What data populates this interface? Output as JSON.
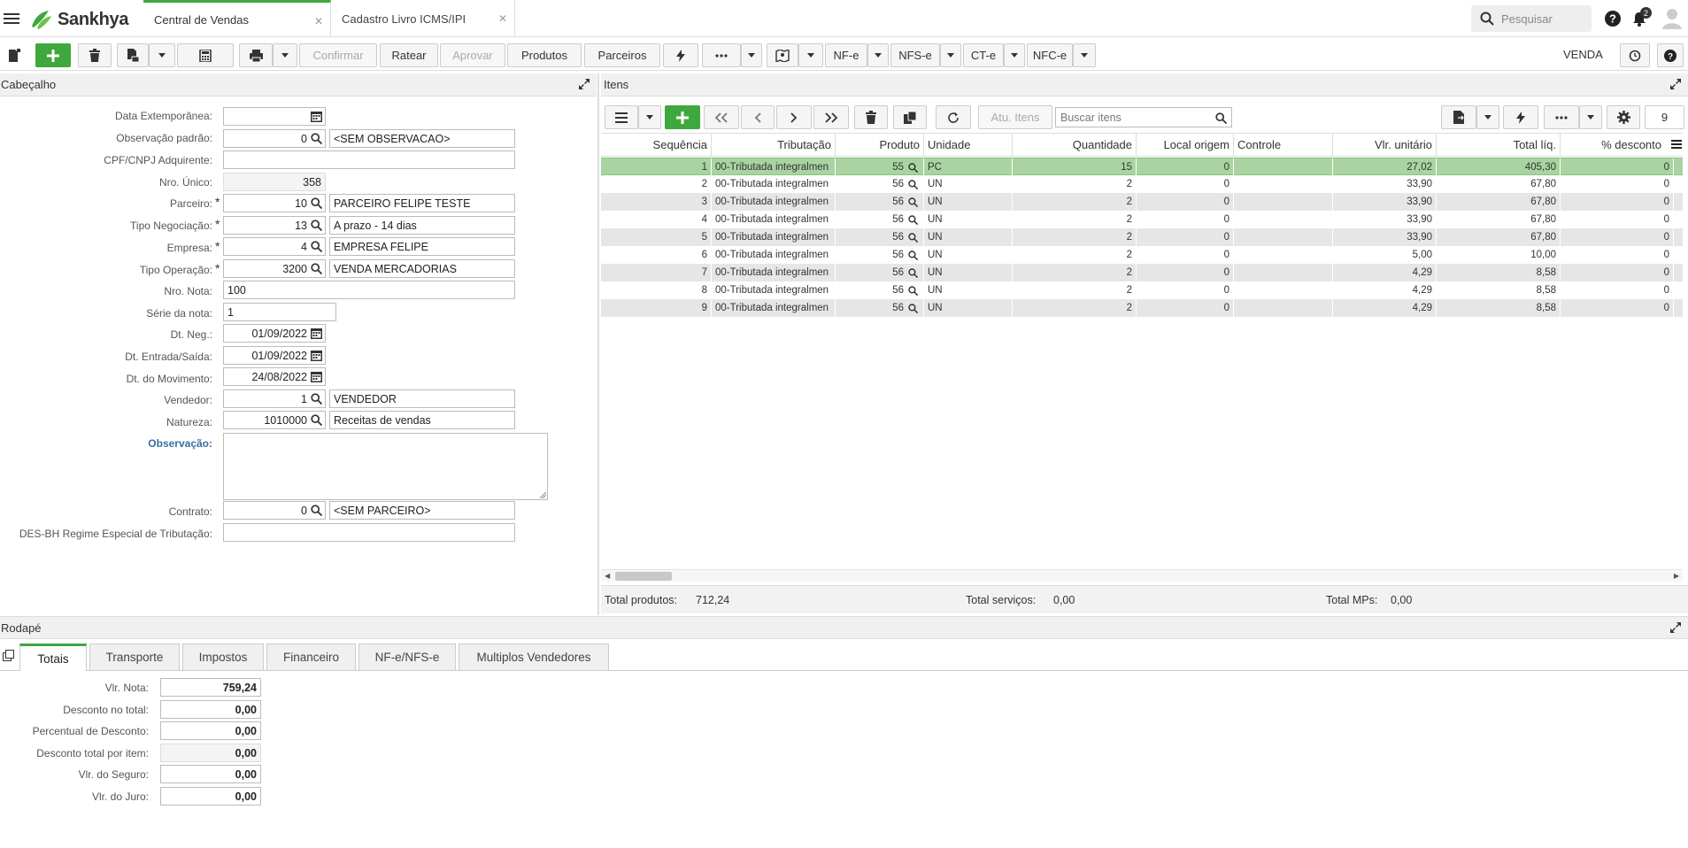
{
  "app": {
    "brand": "Sankhya"
  },
  "tabs": [
    {
      "label": "Central de Vendas",
      "active": true
    },
    {
      "label": "Cadastro Livro ICMS/IPI",
      "active": false
    }
  ],
  "search": {
    "placeholder": "Pesquisar"
  },
  "notifications": {
    "count": "2"
  },
  "toolbar": {
    "confirmar": "Confirmar",
    "ratear": "Ratear",
    "aprovar": "Aprovar",
    "produtos": "Produtos",
    "parceiros": "Parceiros",
    "nfe": "NF-e",
    "nfse": "NFS-e",
    "cte": "CT-e",
    "nfce": "NFC-e",
    "mode": "VENDA"
  },
  "cabecalho": {
    "title": "Cabeçalho",
    "fields": {
      "data_extemporanea": {
        "label": "Data Extemporânea:",
        "value": ""
      },
      "obs_padrao": {
        "label": "Observação padrão:",
        "value": "0",
        "desc": "<SEM OBSERVACAO>"
      },
      "cpf_cnpj": {
        "label": "CPF/CNPJ Adquirente:",
        "value": ""
      },
      "nro_unico": {
        "label": "Nro. Único:",
        "value": "358"
      },
      "parceiro": {
        "label": "Parceiro:",
        "value": "10",
        "desc": "PARCEIRO FELIPE TESTE"
      },
      "tipo_negociacao": {
        "label": "Tipo Negociação:",
        "value": "13",
        "desc": "A prazo - 14 dias"
      },
      "empresa": {
        "label": "Empresa:",
        "value": "4",
        "desc": "EMPRESA FELIPE"
      },
      "tipo_operacao": {
        "label": "Tipo Operação:",
        "value": "3200",
        "desc": "VENDA MERCADORIAS"
      },
      "nro_nota": {
        "label": "Nro. Nota:",
        "value": "100"
      },
      "serie_nota": {
        "label": "Série da nota:",
        "value": "1"
      },
      "dt_neg": {
        "label": "Dt. Neg.:",
        "value": "01/09/2022"
      },
      "dt_entrada_saida": {
        "label": "Dt. Entrada/Saída:",
        "value": "01/09/2022"
      },
      "dt_movimento": {
        "label": "Dt. do Movimento:",
        "value": "24/08/2022"
      },
      "vendedor": {
        "label": "Vendedor:",
        "value": "1",
        "desc": "VENDEDOR"
      },
      "natureza": {
        "label": "Natureza:",
        "value": "1010000",
        "desc": "Receitas de vendas"
      },
      "observacao": {
        "label": "Observação:",
        "value": ""
      },
      "contrato": {
        "label": "Contrato:",
        "value": "0",
        "desc": "<SEM PARCEIRO>"
      },
      "des_bh": {
        "label": "DES-BH Regime Especial de Tributação:",
        "value": ""
      }
    }
  },
  "itens": {
    "title": "Itens",
    "toolbar": {
      "atu_itens": "Atu. Itens",
      "search_placeholder": "Buscar itens",
      "page_count": "9"
    },
    "columns": [
      "Sequência",
      "Tributação",
      "Produto",
      "Unidade",
      "Quantidade",
      "Local origem",
      "Controle",
      "Vlr. unitário",
      "Total líq.",
      "% desconto"
    ],
    "rows": [
      {
        "seq": "1",
        "trib": "00-Tributada integralmen",
        "prod": "55",
        "un": "PC",
        "qtd": "15",
        "local": "0",
        "ctrl": "",
        "vlr": "27,02",
        "total": "405,30",
        "desc": "0",
        "selected": true
      },
      {
        "seq": "2",
        "trib": "00-Tributada integralmen",
        "prod": "56",
        "un": "UN",
        "qtd": "2",
        "local": "0",
        "ctrl": "",
        "vlr": "33,90",
        "total": "67,80",
        "desc": "0"
      },
      {
        "seq": "3",
        "trib": "00-Tributada integralmen",
        "prod": "56",
        "un": "UN",
        "qtd": "2",
        "local": "0",
        "ctrl": "",
        "vlr": "33,90",
        "total": "67,80",
        "desc": "0"
      },
      {
        "seq": "4",
        "trib": "00-Tributada integralmen",
        "prod": "56",
        "un": "UN",
        "qtd": "2",
        "local": "0",
        "ctrl": "",
        "vlr": "33,90",
        "total": "67,80",
        "desc": "0"
      },
      {
        "seq": "5",
        "trib": "00-Tributada integralmen",
        "prod": "56",
        "un": "UN",
        "qtd": "2",
        "local": "0",
        "ctrl": "",
        "vlr": "33,90",
        "total": "67,80",
        "desc": "0"
      },
      {
        "seq": "6",
        "trib": "00-Tributada integralmen",
        "prod": "56",
        "un": "UN",
        "qtd": "2",
        "local": "0",
        "ctrl": "",
        "vlr": "5,00",
        "total": "10,00",
        "desc": "0"
      },
      {
        "seq": "7",
        "trib": "00-Tributada integralmen",
        "prod": "56",
        "un": "UN",
        "qtd": "2",
        "local": "0",
        "ctrl": "",
        "vlr": "4,29",
        "total": "8,58",
        "desc": "0"
      },
      {
        "seq": "8",
        "trib": "00-Tributada integralmen",
        "prod": "56",
        "un": "UN",
        "qtd": "2",
        "local": "0",
        "ctrl": "",
        "vlr": "4,29",
        "total": "8,58",
        "desc": "0"
      },
      {
        "seq": "9",
        "trib": "00-Tributada integralmen",
        "prod": "56",
        "un": "UN",
        "qtd": "2",
        "local": "0",
        "ctrl": "",
        "vlr": "4,29",
        "total": "8,58",
        "desc": "0"
      }
    ],
    "totals": {
      "produtos_label": "Total produtos:",
      "produtos_value": "712,24",
      "servicos_label": "Total serviços:",
      "servicos_value": "0,00",
      "mps_label": "Total MPs:",
      "mps_value": "0,00"
    }
  },
  "rodape": {
    "title": "Rodapé",
    "tabs": [
      "Totais",
      "Transporte",
      "Impostos",
      "Financeiro",
      "NF-e/NFS-e",
      "Multiplos Vendedores"
    ],
    "fields": [
      {
        "label": "Vlr. Nota:",
        "value": "759,24",
        "readonly": false
      },
      {
        "label": "Desconto no total:",
        "value": "0,00",
        "readonly": false
      },
      {
        "label": "Percentual de Desconto:",
        "value": "0,00",
        "readonly": false
      },
      {
        "label": "Desconto total por item:",
        "value": "0,00",
        "readonly": true
      },
      {
        "label": "Vlr. do Seguro:",
        "value": "0,00",
        "readonly": false
      },
      {
        "label": "Vlr. do Juro:",
        "value": "0,00",
        "readonly": false
      }
    ]
  },
  "colors": {
    "accent": "#3ea83e",
    "selected_row": "#a9d4a1",
    "label_blue": "#3b6ea5"
  }
}
